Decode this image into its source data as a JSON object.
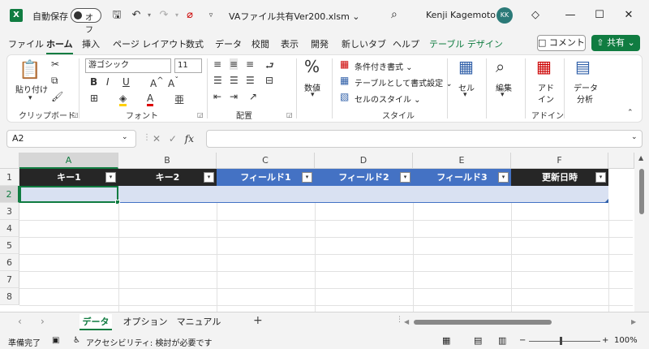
{
  "titlebar": {
    "app_icon": "X",
    "autosave_label": "自動保存",
    "autosave_state": "オフ",
    "filename": "VAファイル共有Ver200.xlsm ⌄",
    "user_name": "Kenji Kagemoto",
    "user_initials": "KK"
  },
  "tabs": [
    "ファイル",
    "ホーム",
    "挿入",
    "ページ レイアウト",
    "数式",
    "データ",
    "校閲",
    "表示",
    "開発",
    "新しいタブ",
    "ヘルプ",
    "テーブル デザイン"
  ],
  "header_buttons": {
    "comment": "□ コメント",
    "share": "⇧ 共有 ⌄"
  },
  "ribbon": {
    "clipboard": {
      "paste": "貼り付け",
      "label": "クリップボード"
    },
    "font": {
      "font_name": "游ゴシック",
      "font_size": "11",
      "label": "フォント"
    },
    "alignment": {
      "label": "配置"
    },
    "number": {
      "button": "数値",
      "symbol": "%"
    },
    "styles": {
      "conditional": "条件付き書式 ⌄",
      "table_format": "テーブルとして書式設定 ⌄",
      "cell_style": "セルのスタイル ⌄",
      "label": "スタイル"
    },
    "cells": {
      "button": "セル"
    },
    "editing": {
      "button": "編集"
    },
    "addins": {
      "button1": "アド",
      "button2": "イン",
      "label": "アドイン"
    },
    "analysis": {
      "button1": "データ",
      "button2": "分析"
    }
  },
  "formula_bar": {
    "name_box": "A2",
    "fx": "fx",
    "value": ""
  },
  "grid": {
    "columns": [
      "A",
      "B",
      "C",
      "D",
      "E",
      "F"
    ],
    "rows": [
      "1",
      "2",
      "3",
      "4",
      "5",
      "6",
      "7",
      "8"
    ],
    "table_headers": [
      "キー1",
      "キー2",
      "フィールド1",
      "フィールド2",
      "フィールド3",
      "更新日時"
    ],
    "filter_symbol": "▾",
    "header_dark_color": "#262626",
    "header_blue_color": "#4472c4",
    "row_band_color": "#d9e1f2"
  },
  "sheets": [
    "データ",
    "オプション",
    "マニュアル"
  ],
  "add_sheet": "+",
  "status": {
    "ready": "準備完了",
    "accessibility": "アクセシビリティ: 検討が必要です",
    "zoom": "100%"
  }
}
